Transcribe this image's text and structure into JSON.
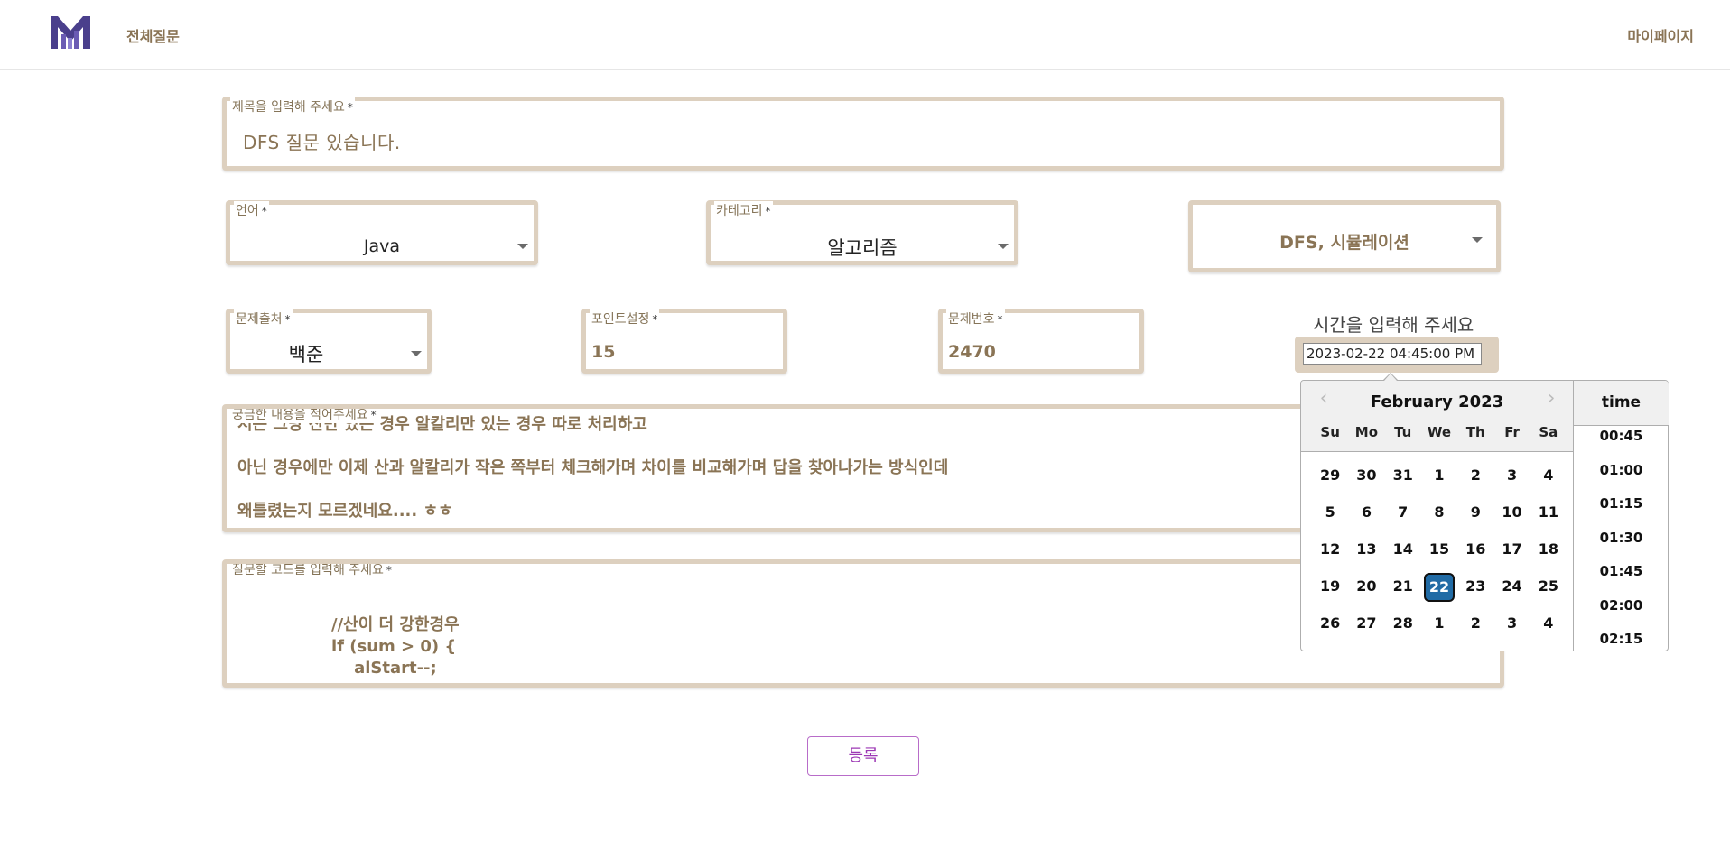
{
  "header": {
    "nav_all": "전체질문",
    "nav_mypage": "마이페이지"
  },
  "title_field": {
    "label": "제목을 입력해 주세요",
    "value": "DFS 질문 있습니다."
  },
  "language_select": {
    "label": "언어",
    "value": "Java"
  },
  "category_select": {
    "label": "카테고리",
    "value": "알고리즘"
  },
  "tag_select": {
    "value": "DFS, 시뮬레이션"
  },
  "source_select": {
    "label": "문제출처",
    "value": "백준"
  },
  "points_field": {
    "label": "포인트설정",
    "value": "15"
  },
  "problem_number_field": {
    "label": "문제번호",
    "value": "2470"
  },
  "time_field": {
    "label": "시간을 입력해 주세요",
    "value": "2023-02-22 04:45:00 PM"
  },
  "content_field": {
    "label": "궁금한 내용을 적어주세요",
    "lines": [
      "서는 그냥 산만 있는 경우 알칼리만 있는 경우 따로 처리하고",
      "아닌 경우에만 이제 산과 알칼리가 작은 쪽부터 체크해가며 차이를 비교해가며 답을 찾아나가는 방식인데",
      "왜틀렸는지 모르겠네요.... ㅎㅎ"
    ]
  },
  "code_field": {
    "label": "질문할 코드를 입력해 주세요",
    "lines": [
      "//산이 더 강한경우",
      "if (sum > 0) {",
      "    alStart--;"
    ]
  },
  "submit_label": "등록",
  "datepicker": {
    "month_label": "February 2023",
    "weekdays": [
      "Su",
      "Mo",
      "Tu",
      "We",
      "Th",
      "Fr",
      "Sa"
    ],
    "weeks": [
      [
        "29",
        "30",
        "31",
        "1",
        "2",
        "3",
        "4"
      ],
      [
        "5",
        "6",
        "7",
        "8",
        "9",
        "10",
        "11"
      ],
      [
        "12",
        "13",
        "14",
        "15",
        "16",
        "17",
        "18"
      ],
      [
        "19",
        "20",
        "21",
        "22",
        "23",
        "24",
        "25"
      ],
      [
        "26",
        "27",
        "28",
        "1",
        "2",
        "3",
        "4"
      ]
    ],
    "selected_day": "22",
    "time_header": "time",
    "times": [
      "00:45",
      "01:00",
      "01:15",
      "01:30",
      "01:45",
      "02:00",
      "02:15"
    ],
    "selected_color": "#216ba5"
  },
  "required_mark": "*",
  "icons": {
    "logo": "m-logo",
    "dropdown": "chevron-down-icon",
    "prev": "chevron-left-icon",
    "next": "chevron-right-icon"
  }
}
